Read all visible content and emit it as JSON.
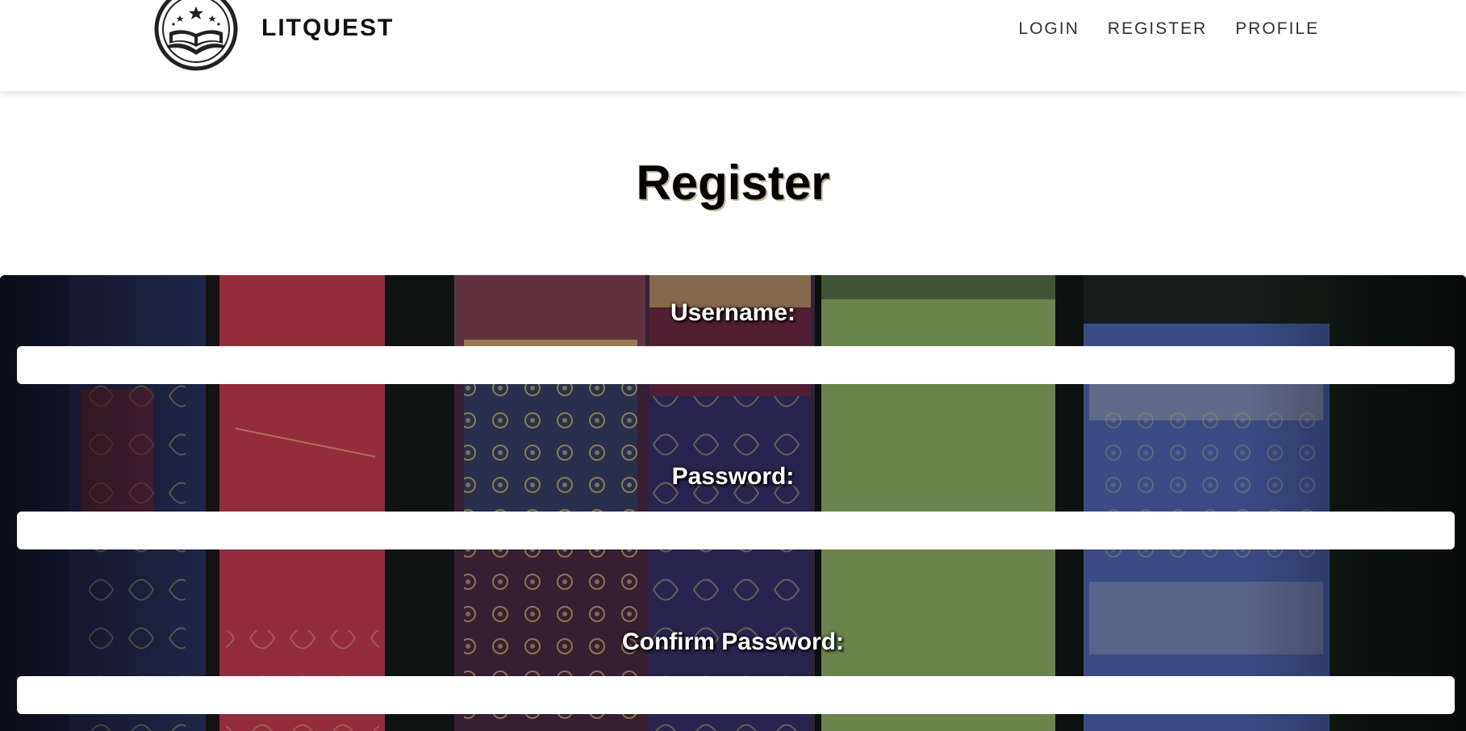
{
  "header": {
    "brand": "LITQUEST",
    "logo": "open-book-with-stars-logo",
    "nav": [
      {
        "label": "LOGIN"
      },
      {
        "label": "REGISTER"
      },
      {
        "label": "PROFILE"
      }
    ]
  },
  "page": {
    "title": "Register"
  },
  "form": {
    "background": "vintage-book-spines-photo",
    "fields": [
      {
        "label": "Username:",
        "value": "",
        "placeholder": ""
      },
      {
        "label": "Password:",
        "value": "",
        "placeholder": ""
      },
      {
        "label": "Confirm Password:",
        "value": "",
        "placeholder": ""
      }
    ]
  },
  "colors": {
    "background": "#ffffff",
    "text": "#111111",
    "nav_text": "#333333",
    "title_shadow": "#c9b79b",
    "input_bg": "#ffffff",
    "label_text": "#ffffff"
  }
}
